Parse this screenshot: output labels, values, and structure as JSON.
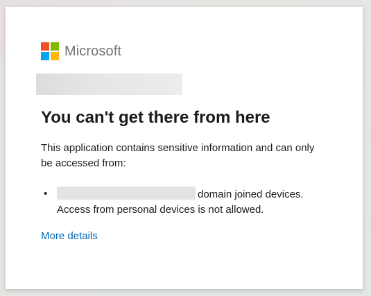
{
  "brand": {
    "name": "Microsoft",
    "logo_icon": "microsoft-logo-icon",
    "logo_colors": [
      "#f25022",
      "#7fba00",
      "#00a4ef",
      "#ffb900"
    ]
  },
  "main": {
    "title": "You can't get there from here",
    "description": "This application contains sensitive information and can only be accessed from:",
    "requirements": [
      {
        "bullet": "•",
        "text_line1": "domain joined devices.",
        "text_line2": "Access from personal devices is not allowed."
      }
    ],
    "more_details_label": "More details"
  },
  "colors": {
    "link": "#0067b8",
    "text": "#1b1b1b",
    "brand_text": "#737373"
  }
}
